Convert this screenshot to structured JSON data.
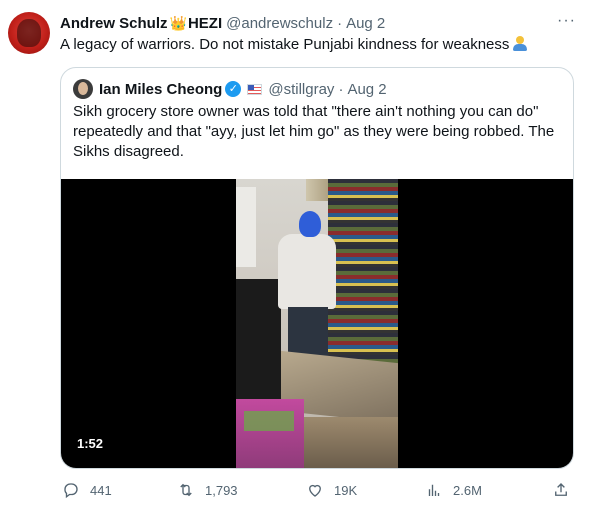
{
  "tweet": {
    "author_name": "Andrew Schulz",
    "author_suffix": "HEZI",
    "crown": "👑",
    "handle": "@andrewschulz",
    "separator": "·",
    "date": "Aug 2",
    "text": "A legacy of warriors. Do not mistake Punjabi kindness for weakness",
    "more_icon": "more-horizontal-icon",
    "more_glyph": "···"
  },
  "quoted": {
    "author_name": "Ian Miles Cheong",
    "verified_glyph": "✓",
    "handle": "@stillgray",
    "separator": "·",
    "date": "Aug 2",
    "text": "Sikh grocery store owner was told that \"there ain't nothing you can do\" repeatedly and that \"ayy, just let him go\" as they were being robbed. The Sikhs disagreed.",
    "video": {
      "duration": "1:52"
    }
  },
  "actions": {
    "replies": "441",
    "retweets": "1,793",
    "likes": "19K",
    "views": "2.6M"
  },
  "colors": {
    "text": "#0f1419",
    "secondary": "#536471",
    "border": "#cfd9de",
    "verified": "#1d9bf0"
  }
}
